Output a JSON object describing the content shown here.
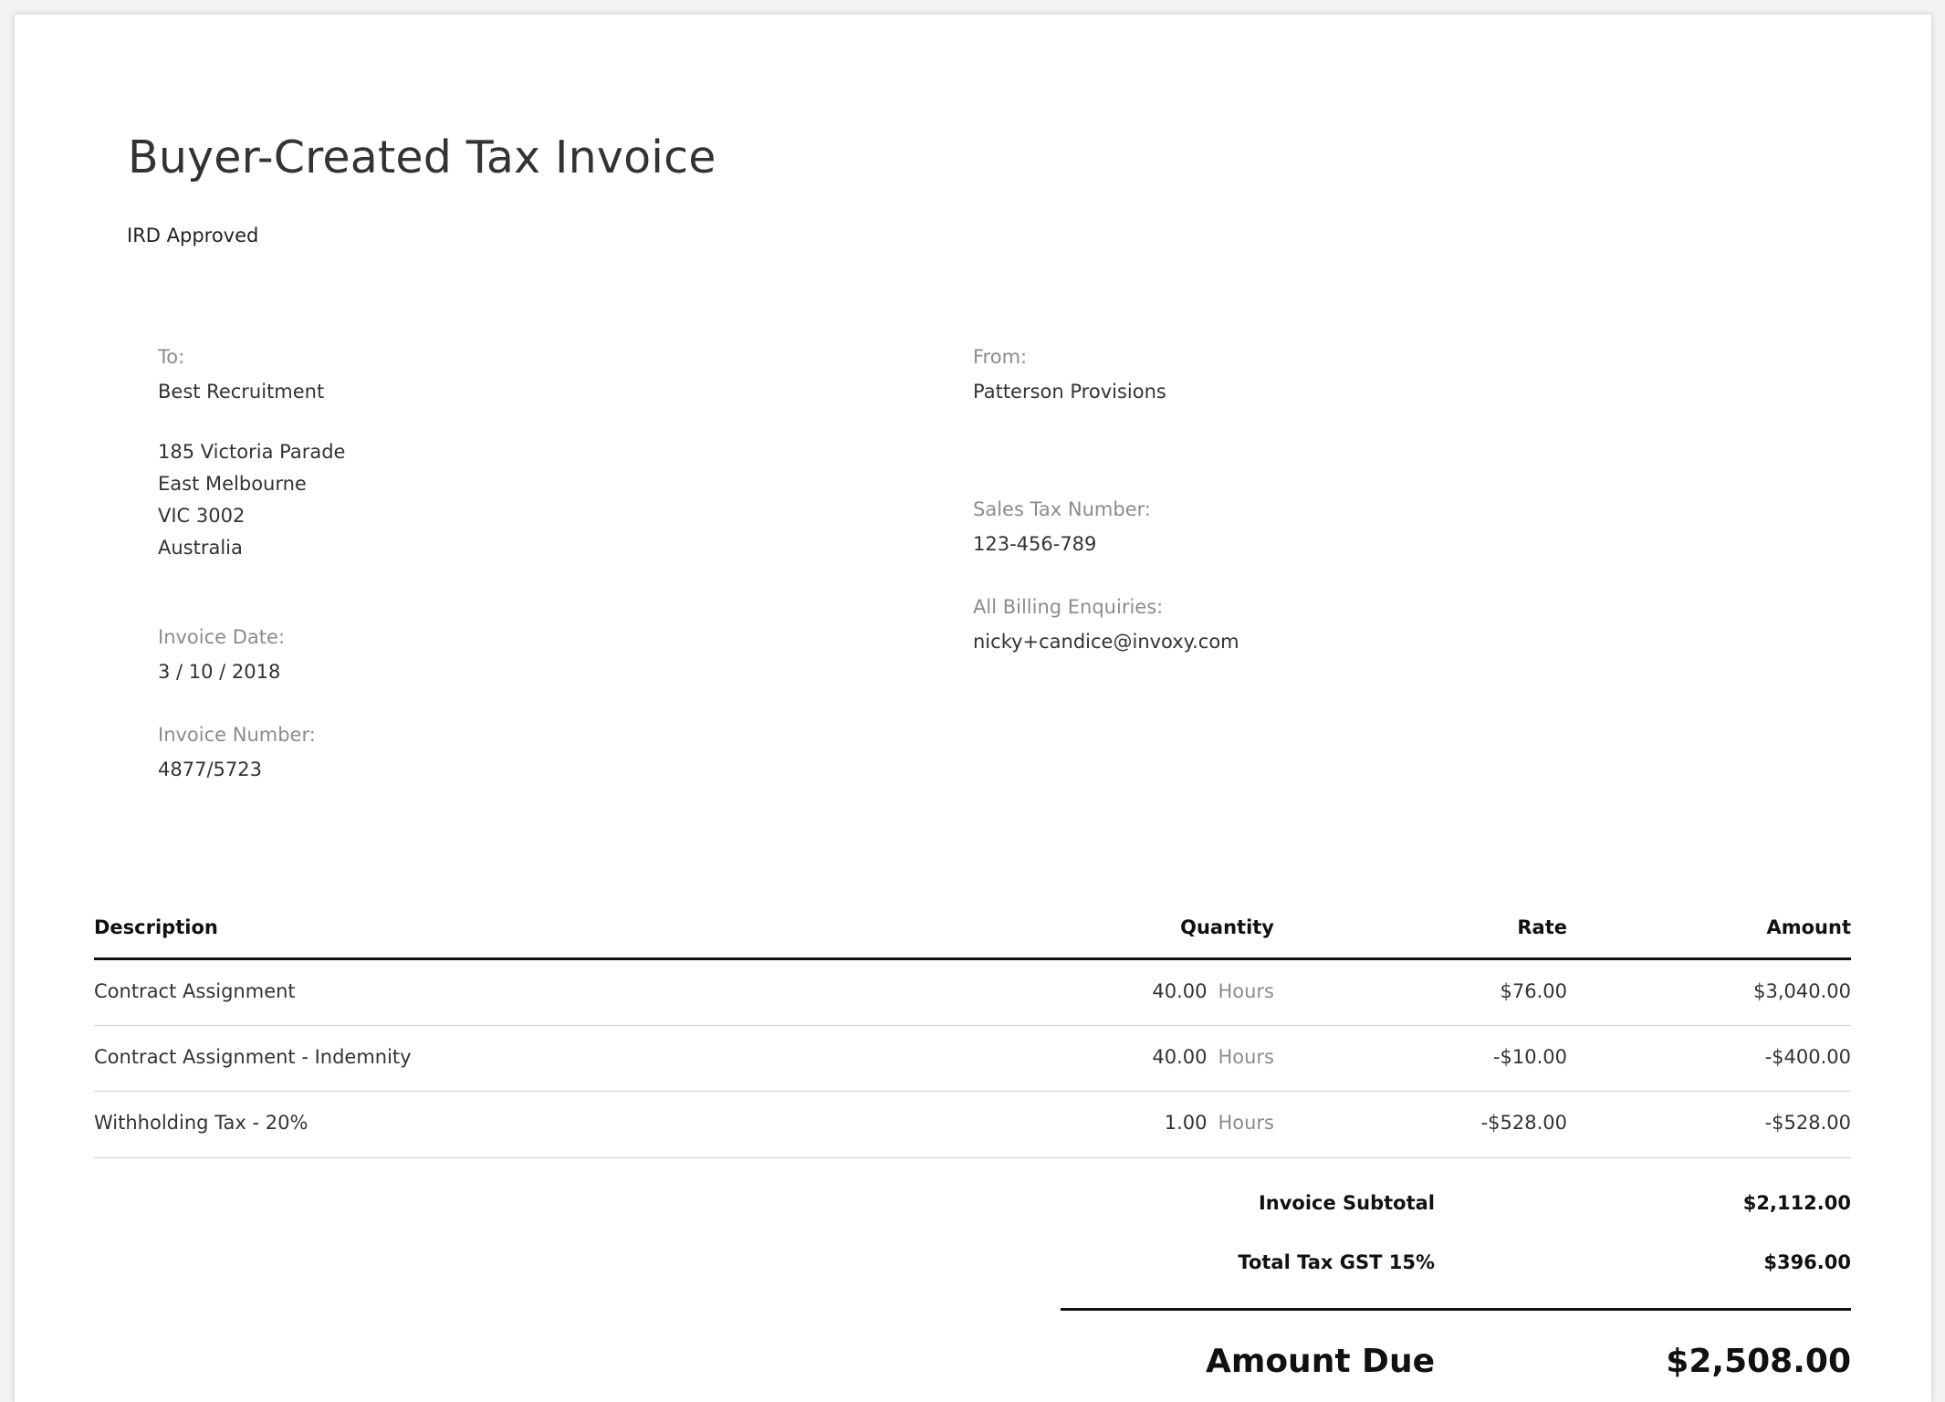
{
  "document": {
    "title": "Buyer-Created Tax Invoice",
    "subtitle": "IRD Approved"
  },
  "to": {
    "label": "To:",
    "name": "Best Recruitment",
    "address": [
      "185 Victoria Parade",
      "East Melbourne",
      "VIC 3002",
      "Australia"
    ]
  },
  "from": {
    "label": "From:",
    "name": "Patterson Provisions"
  },
  "sales_tax": {
    "label": "Sales Tax Number:",
    "value": "123-456-789"
  },
  "billing": {
    "label": "All Billing Enquiries:",
    "value": "nicky+candice@invoxy.com"
  },
  "invoice_date": {
    "label": "Invoice Date:",
    "value": "3 / 10 / 2018"
  },
  "invoice_number": {
    "label": "Invoice Number:",
    "value": "4877/5723"
  },
  "table": {
    "headers": {
      "description": "Description",
      "quantity": "Quantity",
      "rate": "Rate",
      "amount": "Amount"
    },
    "rows": [
      {
        "description": "Contract Assignment",
        "quantity": "40.00",
        "unit": "Hours",
        "rate": "$76.00",
        "amount": "$3,040.00"
      },
      {
        "description": "Contract Assignment - Indemnity",
        "quantity": "40.00",
        "unit": "Hours",
        "rate": "-$10.00",
        "amount": "-$400.00"
      },
      {
        "description": "Withholding Tax - 20%",
        "quantity": "1.00",
        "unit": "Hours",
        "rate": "-$528.00",
        "amount": "-$528.00"
      }
    ]
  },
  "totals": {
    "subtotal_label": "Invoice Subtotal",
    "subtotal_value": "$2,112.00",
    "tax_label": "Total Tax GST 15%",
    "tax_value": "$396.00",
    "due_label": "Amount Due",
    "due_value": "$2,508.00"
  }
}
